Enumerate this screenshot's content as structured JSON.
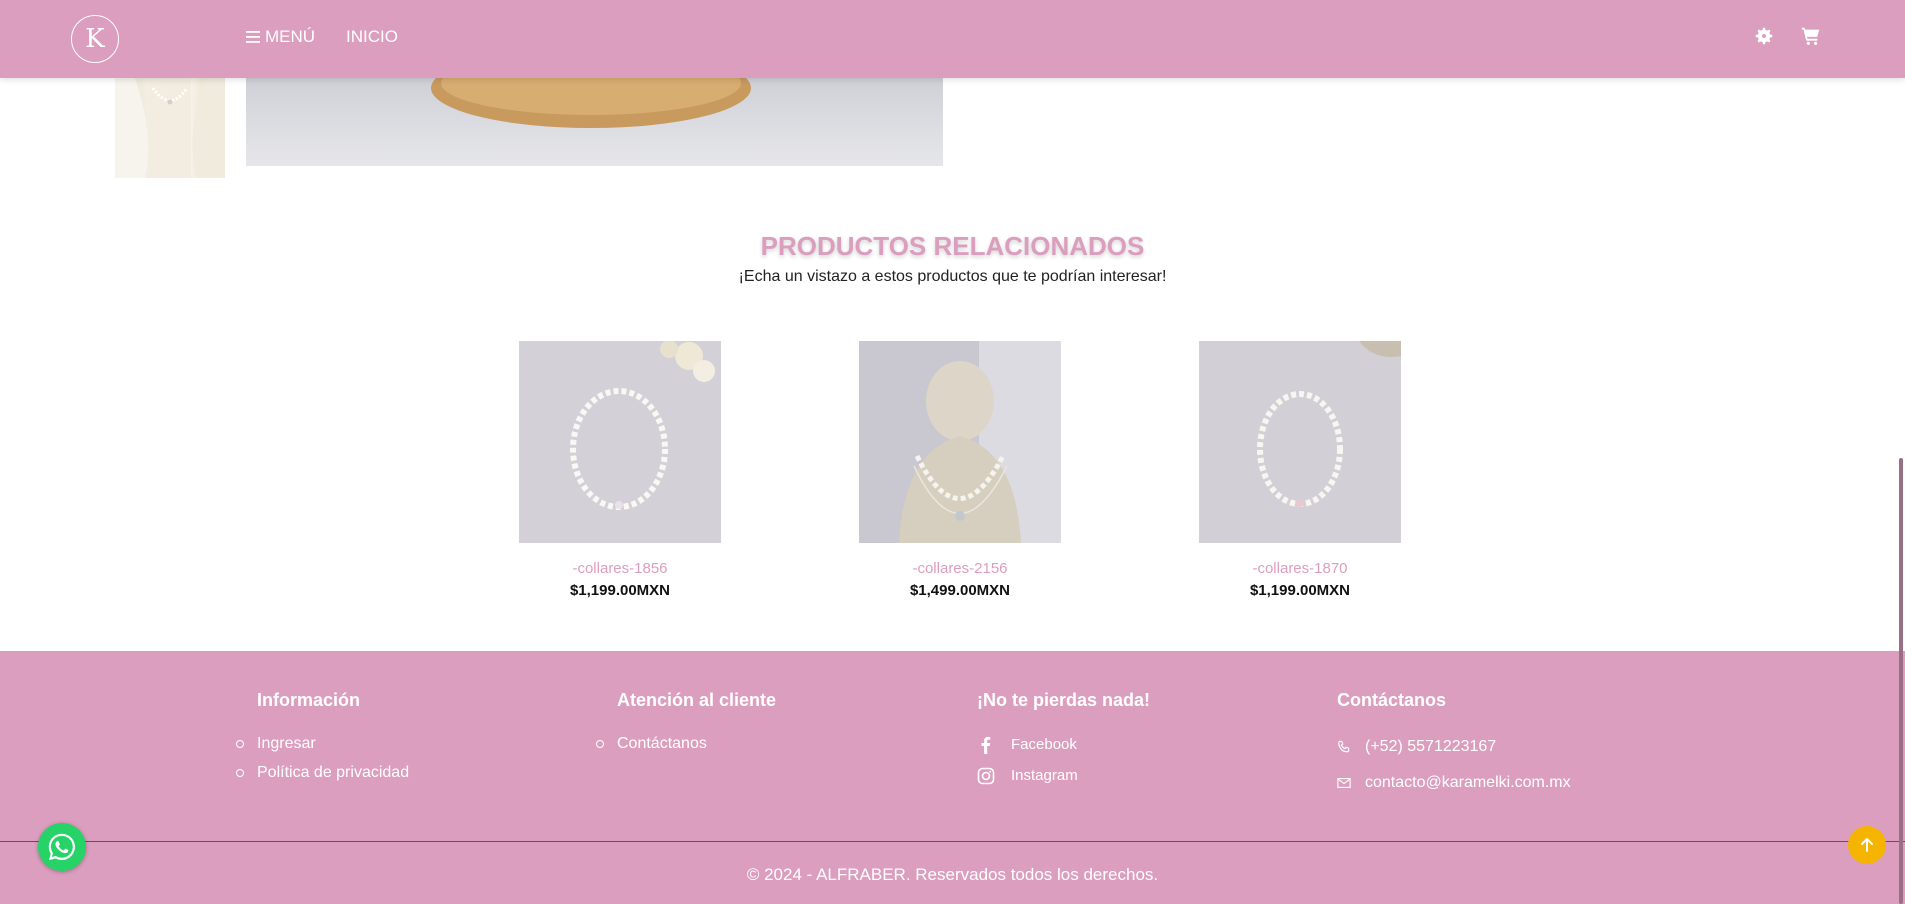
{
  "header": {
    "logo_letter": "K",
    "menu_label": "MENÚ",
    "home_label": "INICIO"
  },
  "related": {
    "title": "PRODUCTOS RELACIONADOS",
    "subtitle": "¡Echa un vistazo a estos productos que te podrían interesar!",
    "products": [
      {
        "name": "-collares-1856",
        "price": "$1,199.00MXN"
      },
      {
        "name": "-collares-2156",
        "price": "$1,499.00MXN"
      },
      {
        "name": "-collares-1870",
        "price": "$1,199.00MXN"
      }
    ]
  },
  "footer": {
    "info": {
      "heading": "Información",
      "links": [
        "Ingresar",
        "Política de privacidad"
      ]
    },
    "support": {
      "heading": "Atención al cliente",
      "links": [
        "Contáctanos"
      ]
    },
    "social": {
      "heading": "¡No te pierdas nada!",
      "facebook": "Facebook",
      "instagram": "Instagram"
    },
    "contact": {
      "heading": "Contáctanos",
      "phone": "(+52) 5571223167",
      "email": "contacto@karamelki.com.mx"
    },
    "copyright": "© 2024 - ALFRABER. Reservados todos los derechos."
  },
  "colors": {
    "brand_pink": "#dc9ebe",
    "whatsapp_green": "#25d366",
    "scroll_top_yellow": "#f4b400"
  },
  "icons": [
    "menu-icon",
    "gear-icon",
    "cart-icon",
    "facebook-icon",
    "instagram-icon",
    "phone-icon",
    "email-icon",
    "whatsapp-icon",
    "arrow-up-icon"
  ]
}
